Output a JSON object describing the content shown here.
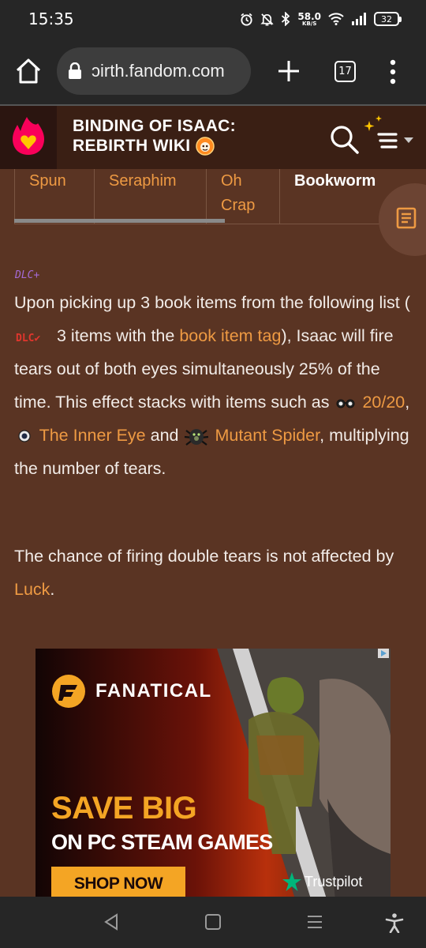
{
  "status_bar": {
    "time": "15:35",
    "net_speed": "58.0",
    "net_unit": "KB/S",
    "battery": "32",
    "icons": [
      "alarm-icon",
      "bell-off-icon",
      "bluetooth-icon",
      "wifi-icon",
      "signal-icon",
      "battery-icon"
    ]
  },
  "browser": {
    "url": "ɔirth.fandom.com",
    "tab_count": "17",
    "icons": [
      "home-icon",
      "lock-icon",
      "plus-icon",
      "tabs-icon",
      "more-vert-icon"
    ]
  },
  "wiki": {
    "title_line1": "BINDING OF ISAAC:",
    "title_line2": "REBIRTH WIKI",
    "icons": [
      "fandom-logo",
      "wiki-badge-icon",
      "search-icon",
      "menu-icon"
    ]
  },
  "table": {
    "cells": [
      [
        "Spun"
      ],
      [
        "Seraphim"
      ],
      [
        "Oh",
        "Crap"
      ],
      [
        "Bookworm"
      ]
    ]
  },
  "article": {
    "dlc_plus": "DLC+",
    "dlc_v": "DLC✔",
    "p1_a": "Upon picking up 3 book items from the following list (",
    "p1_b": " 3 items with the ",
    "link_book": "book",
    "link_item_tag_1": "item",
    "link_item_tag_2": "tag",
    "p1_c": "), Isaac will fire tears out of both eyes simultaneously 25% of the time. This effect stacks with items such as ",
    "link_2020": "20/20",
    "p1_d": ", ",
    "link_inner_eye": "The Inner Eye",
    "p1_e": " and ",
    "link_mutant_spider": "Mutant Spider",
    "p1_f": ", multiplying the number of tears.",
    "p2_a": "The chance of firing double tears is not affected by ",
    "link_luck": "Luck",
    "p2_b": "."
  },
  "ad": {
    "brand": "FANATICAL",
    "headline": "SAVE BIG",
    "sub": "ON PC STEAM GAMES",
    "cta": "SHOP NOW",
    "trust": "Trustpilot"
  },
  "colors": {
    "background": "#5a3423",
    "link": "#ee9a43",
    "header": "#3a1f14",
    "ad_accent": "#f4a524",
    "trustpilot": "#00b67a"
  }
}
